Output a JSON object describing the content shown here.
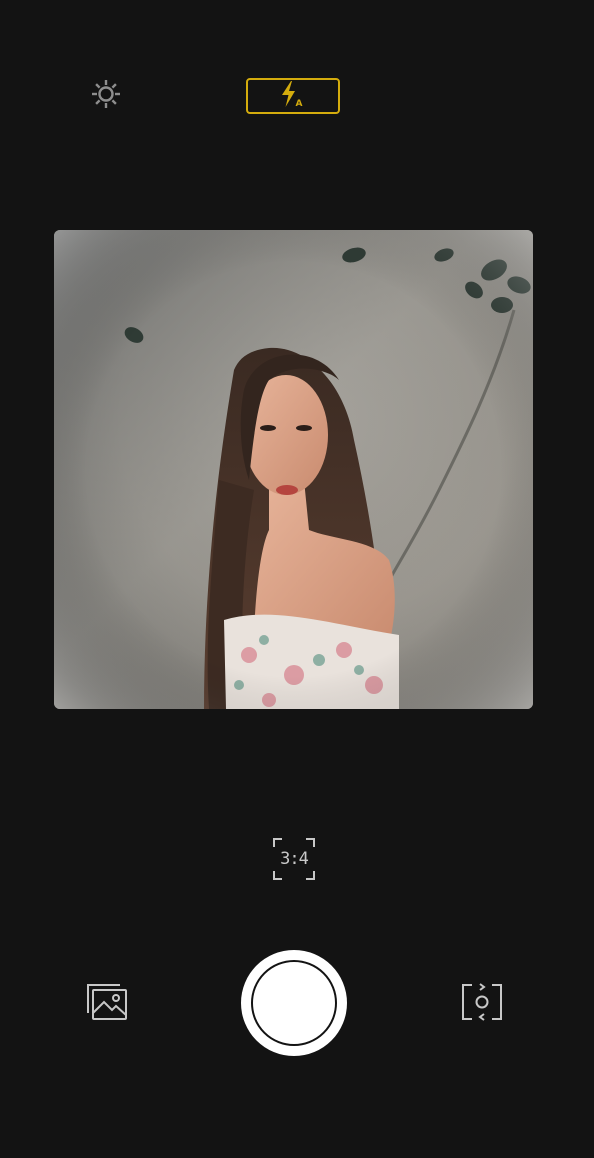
{
  "top_bar": {
    "settings_icon": "gear-icon",
    "flash": {
      "icon": "flash-auto-icon",
      "mode_letter": "A",
      "accent_color": "#d4ac0d"
    }
  },
  "viewfinder": {
    "preview": "camera-preview-image"
  },
  "aspect_ratio": {
    "label": "3:4"
  },
  "bottom_bar": {
    "gallery_icon": "gallery-icon",
    "shutter": "shutter-button",
    "flip_icon": "flip-camera-icon"
  },
  "colors": {
    "background": "#131313",
    "icon": "#c8c8c8",
    "accent": "#d4ac0d",
    "shutter": "#ffffff"
  }
}
